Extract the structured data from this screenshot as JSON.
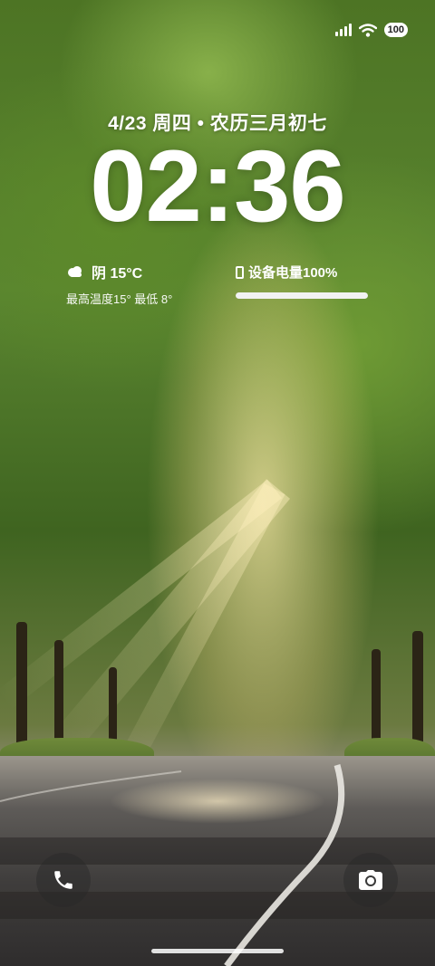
{
  "status_bar": {
    "battery_level": "100",
    "icons": [
      "signal-icon",
      "wifi-icon",
      "battery-icon"
    ]
  },
  "lockscreen": {
    "date": "4/23 周四 • 农历三月初七",
    "time": "02:36"
  },
  "weather": {
    "condition_icon": "cloud-icon",
    "summary": "阴 15°C",
    "range": "最高温度15° 最低 8°"
  },
  "device_battery": {
    "label": "设备电量100%",
    "level_percent": 100
  },
  "shortcuts": {
    "left_icon": "phone-icon",
    "right_icon": "camera-icon"
  }
}
